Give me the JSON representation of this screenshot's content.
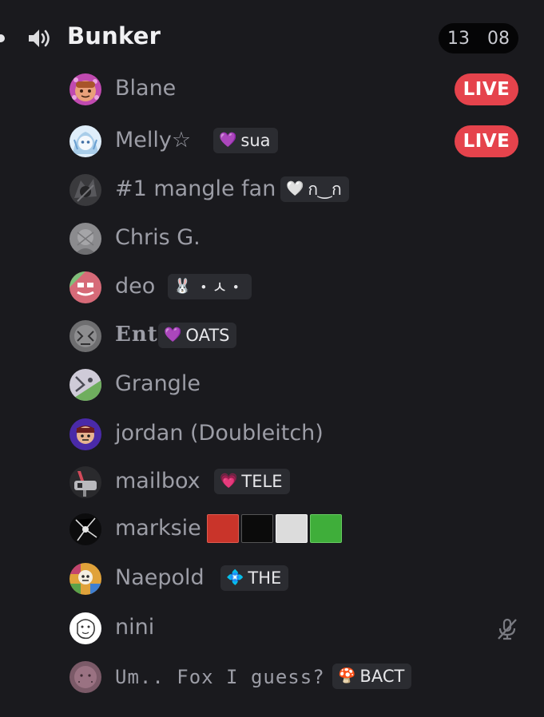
{
  "channel": {
    "name": "Bunker",
    "counter_left": "13",
    "counter_right": "08",
    "icon": "speaker-icon"
  },
  "live_label": "LIVE",
  "colors": {
    "background": "#1a1a1e",
    "live": "#e5434c",
    "tag_bg": "#2b2c31"
  },
  "users": [
    {
      "name": "Blane",
      "live": true
    },
    {
      "name": "Melly☆",
      "live": true,
      "tag": {
        "glyph": "💜",
        "text": "sua",
        "glyph_color": "#e0b6ff"
      }
    },
    {
      "name": "#1 mangle fan",
      "tag": {
        "glyph": "🤍",
        "text": "ก‿ก",
        "glyph_color": "#ffffff"
      }
    },
    {
      "name": "Chris G."
    },
    {
      "name": "deo",
      "tag": {
        "glyph": "🐰",
        "text": "・ㅅ・",
        "glyph_color": "#ff9fd1"
      }
    },
    {
      "name": "Ent",
      "tag": {
        "glyph": "💜",
        "text": "OATS",
        "glyph_color": "#b79bff"
      }
    },
    {
      "name": "Grangle"
    },
    {
      "name": "jordan (Doubleitch)"
    },
    {
      "name": "mailbox",
      "tag": {
        "glyph": "💗",
        "text": "TELE",
        "glyph_color": "#ff8fc4"
      }
    },
    {
      "name": "marksie",
      "swatches": [
        "#c9342a",
        "#0b0b0b",
        "#dcdcdc",
        "#3fae3a"
      ]
    },
    {
      "name": "Naepold",
      "tag": {
        "glyph": "💠",
        "text": "THE",
        "glyph_color": "#9fd8ff"
      }
    },
    {
      "name": "nini",
      "muted": true,
      "mute_icon": "microphone-muted-icon"
    },
    {
      "name": "Um.. Fox I guess?",
      "tag": {
        "glyph": "🍄",
        "text": "BACT",
        "glyph_color": "#5fb84e"
      }
    }
  ]
}
